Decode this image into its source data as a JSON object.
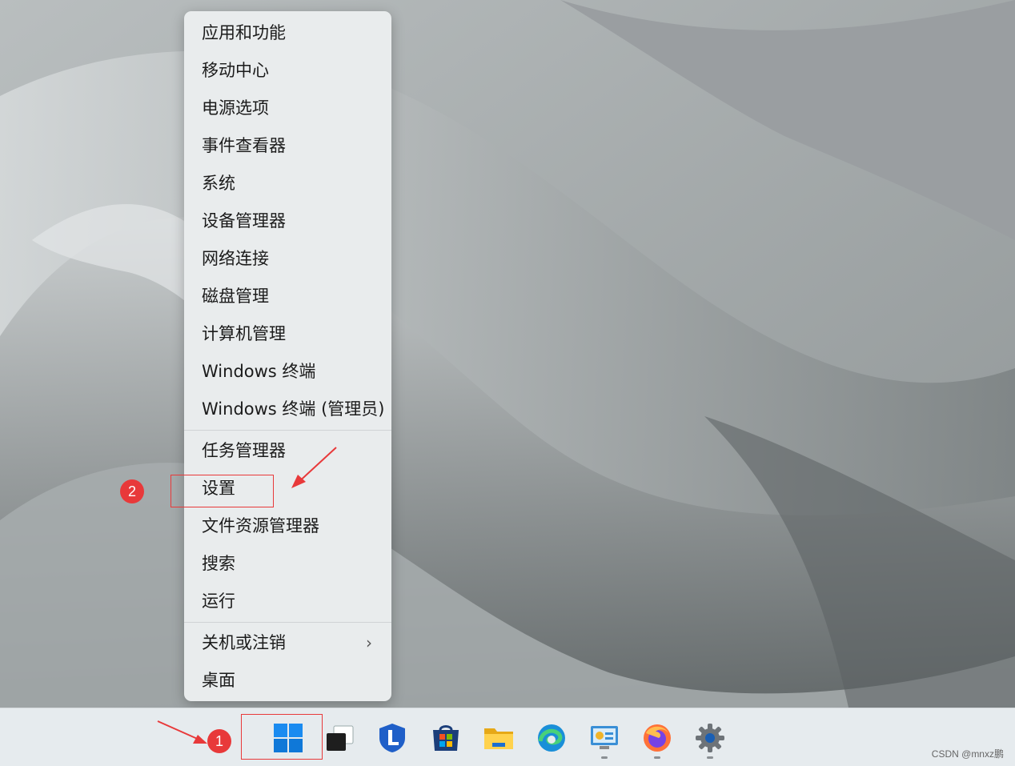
{
  "menu": {
    "groups": [
      [
        {
          "label": "应用和功能"
        },
        {
          "label": "移动中心"
        },
        {
          "label": "电源选项"
        },
        {
          "label": "事件查看器"
        },
        {
          "label": "系统"
        },
        {
          "label": "设备管理器"
        },
        {
          "label": "网络连接"
        },
        {
          "label": "磁盘管理"
        },
        {
          "label": "计算机管理"
        },
        {
          "label": "Windows 终端"
        },
        {
          "label": "Windows 终端 (管理员)"
        }
      ],
      [
        {
          "label": "任务管理器"
        },
        {
          "label": "设置"
        },
        {
          "label": "文件资源管理器"
        },
        {
          "label": "搜索"
        },
        {
          "label": "运行"
        }
      ],
      [
        {
          "label": "关机或注销",
          "has_submenu": true
        },
        {
          "label": "桌面"
        }
      ]
    ]
  },
  "taskbar": {
    "icons": [
      "windows-start-icon",
      "task-view-icon",
      "lenovo-icon",
      "store-icon",
      "file-explorer-icon",
      "edge-icon",
      "control-panel-icon",
      "firefox-icon",
      "settings-icon"
    ],
    "watermark": "CSDN @mnxz鹏"
  },
  "annotations": {
    "badge1": "1",
    "badge2": "2",
    "accent": "#e8393a"
  }
}
